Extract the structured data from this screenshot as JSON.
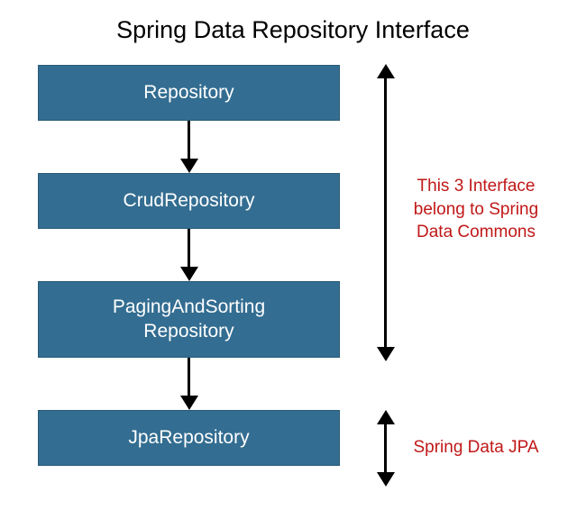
{
  "title": "Spring Data Repository Interface",
  "boxes": {
    "repository": "Repository",
    "crud": "CrudRepository",
    "paging_line1": "PagingAndSorting",
    "paging_line2": "Repository",
    "jpa": "JpaRepository"
  },
  "annotations": {
    "commons_line1": "This 3 Interface",
    "commons_line2": "belong to Spring",
    "commons_line3": "Data Commons",
    "jpa": "Spring Data JPA"
  },
  "colors": {
    "box_bg": "#336d91",
    "box_text": "#ffffff",
    "annotation_text": "#c01818"
  }
}
